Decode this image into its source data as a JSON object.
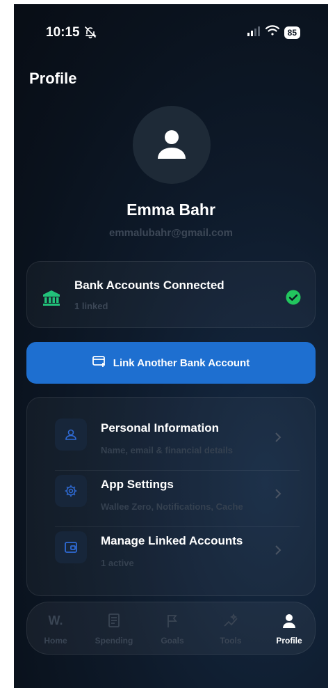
{
  "status": {
    "time": "10:15",
    "battery": "85"
  },
  "page": {
    "title": "Profile"
  },
  "user": {
    "name": "Emma Bahr",
    "email": "emmalubahr@gmail.com"
  },
  "bank": {
    "title": "Bank Accounts Connected",
    "subtitle": "1 linked"
  },
  "link_button": {
    "label": "Link Another Bank Account"
  },
  "menu": {
    "items": [
      {
        "title": "Personal Information",
        "subtitle": "Name, email & financial details"
      },
      {
        "title": "App Settings",
        "subtitle": "Wallee Zero, Notifications, Cache"
      },
      {
        "title": "Manage Linked Accounts",
        "subtitle": "1 active"
      }
    ]
  },
  "tabs": {
    "logo": "W.",
    "items": [
      {
        "label": "Home"
      },
      {
        "label": "Spending"
      },
      {
        "label": "Goals"
      },
      {
        "label": "Tools"
      },
      {
        "label": "Profile"
      }
    ],
    "active": "Profile"
  },
  "colors": {
    "accent": "#1e6fd0",
    "success": "#22c55e",
    "bank_icon": "#22c27a",
    "menu_icon": "#2f6bd6",
    "muted_text": "#3c4756"
  },
  "icons": {
    "bell": "bell-slash-icon",
    "signal": "signal-icon",
    "wifi": "wifi-icon",
    "avatar": "person-icon",
    "bank": "bank-icon",
    "check": "check-circle-icon",
    "link": "card-plus-icon",
    "personal": "user-icon",
    "settings": "gear-icon",
    "wallet": "wallet-icon",
    "chevron": "chevron-right-icon"
  }
}
